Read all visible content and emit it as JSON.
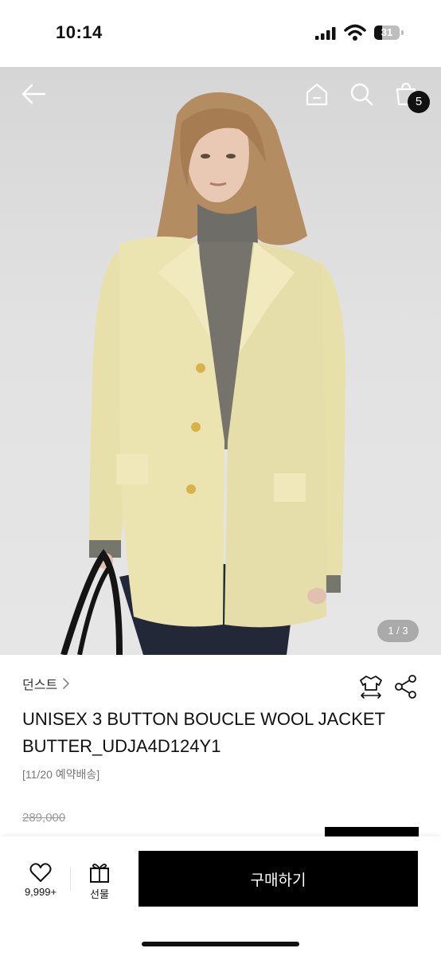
{
  "status_bar": {
    "time": "10:14",
    "battery": "31",
    "battery_level": 0.31
  },
  "nav": {
    "cart_count": "5"
  },
  "gallery": {
    "counter": "1 / 3"
  },
  "product": {
    "brand": "던스트",
    "title": "UNISEX 3 BUTTON BOUCLE WOOL JACKET BUTTER_UDJA4D124Y1",
    "delivery_note": "[11/20 예약배송]",
    "original_price": "289,000"
  },
  "bottom_bar": {
    "like_count": "9,999+",
    "gift_label": "선물",
    "buy_label": "구매하기"
  },
  "colors": {
    "accent": "#000000",
    "jacket": "#ebe3b0",
    "badge": "#111111"
  }
}
